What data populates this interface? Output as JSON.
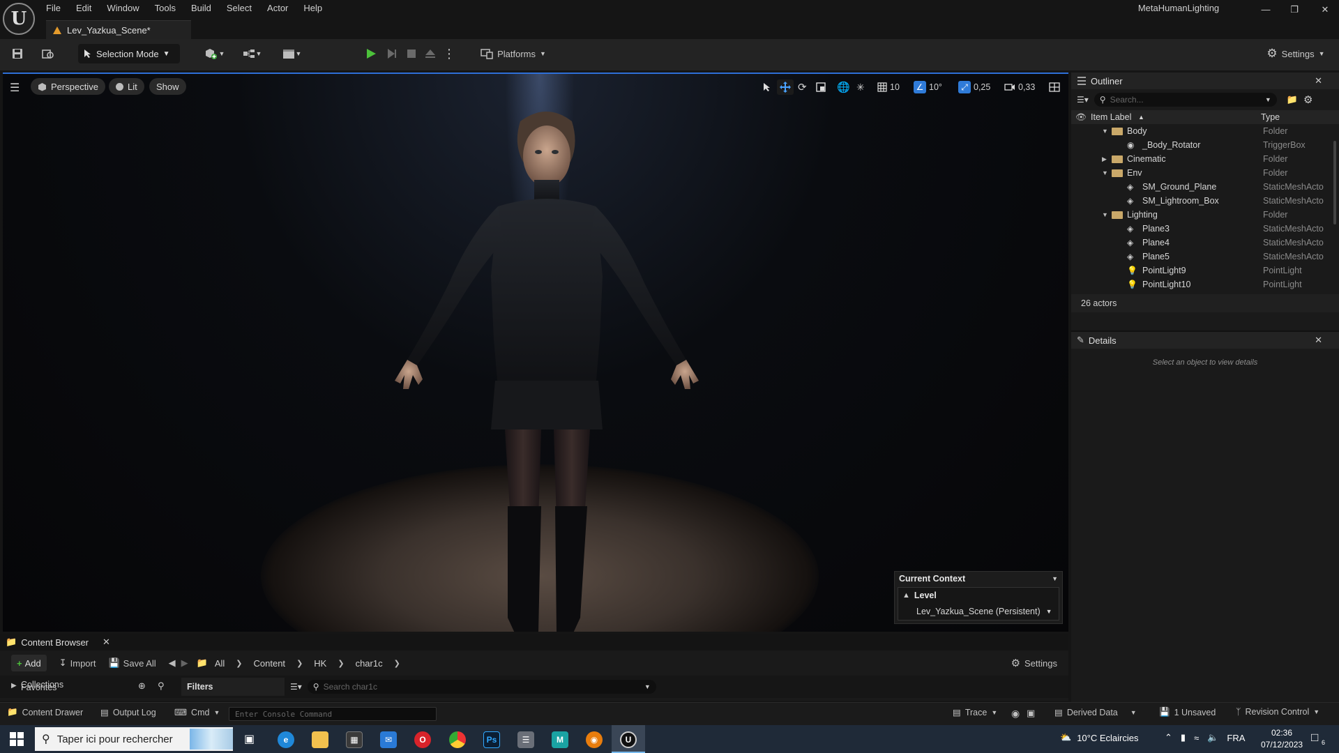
{
  "menu": [
    "File",
    "Edit",
    "Window",
    "Tools",
    "Build",
    "Select",
    "Actor",
    "Help"
  ],
  "app_name": "MetaHumanLighting",
  "document_tab": "Lev_Yazkua_Scene*",
  "toolbar": {
    "selection_mode": "Selection Mode",
    "platforms": "Platforms",
    "settings": "Settings"
  },
  "viewport": {
    "perspective": "Perspective",
    "lit": "Lit",
    "show": "Show",
    "grid_size": "10",
    "angle_snap": "10°",
    "scale_snap": "0,25",
    "camera_speed": "0,33"
  },
  "context": {
    "title": "Current Context",
    "level_label": "Level",
    "level_value": "Lev_Yazkua_Scene (Persistent)"
  },
  "outliner": {
    "title": "Outliner",
    "search_placeholder": "Search...",
    "col_label": "Item Label",
    "col_type": "Type",
    "items": [
      {
        "label": "Body",
        "type": "Folder",
        "indent": 0,
        "kind": "folder",
        "expanded": true
      },
      {
        "label": "_Body_Rotator",
        "type": "TriggerBox",
        "indent": 1,
        "kind": "trigger"
      },
      {
        "label": "Cinematic",
        "type": "Folder",
        "indent": 0,
        "kind": "folder",
        "expanded": false
      },
      {
        "label": "Env",
        "type": "Folder",
        "indent": 0,
        "kind": "folder",
        "expanded": true
      },
      {
        "label": "SM_Ground_Plane",
        "type": "StaticMeshActo",
        "indent": 1,
        "kind": "mesh"
      },
      {
        "label": "SM_Lightroom_Box",
        "type": "StaticMeshActo",
        "indent": 1,
        "kind": "mesh"
      },
      {
        "label": "Lighting",
        "type": "Folder",
        "indent": 0,
        "kind": "folder",
        "expanded": true
      },
      {
        "label": "Plane3",
        "type": "StaticMeshActo",
        "indent": 1,
        "kind": "mesh"
      },
      {
        "label": "Plane4",
        "type": "StaticMeshActo",
        "indent": 1,
        "kind": "mesh"
      },
      {
        "label": "Plane5",
        "type": "StaticMeshActo",
        "indent": 1,
        "kind": "mesh"
      },
      {
        "label": "PointLight9",
        "type": "PointLight",
        "indent": 1,
        "kind": "light"
      },
      {
        "label": "PointLight10",
        "type": "PointLight",
        "indent": 1,
        "kind": "light"
      }
    ],
    "count": "26 actors"
  },
  "details": {
    "title": "Details",
    "empty": "Select an object to view details"
  },
  "content_browser": {
    "title": "Content Browser",
    "add": "Add",
    "import": "Import",
    "save_all": "Save All",
    "crumbs": [
      "All",
      "Content",
      "HK",
      "char1c"
    ],
    "settings": "Settings",
    "collections": "Collections",
    "favorites": "Favorites",
    "filters": "Filters",
    "search_placeholder": "Search char1c"
  },
  "statusbar": {
    "content_drawer": "Content Drawer",
    "output_log": "Output Log",
    "cmd": "Cmd",
    "console_placeholder": "Enter Console Command",
    "trace": "Trace",
    "derived_data": "Derived Data",
    "unsaved": "1 Unsaved",
    "revision": "Revision Control"
  },
  "taskbar": {
    "search_placeholder": "Taper ici pour rechercher",
    "weather": "10°C  Eclaircies",
    "lang": "FRA",
    "time": "02:36",
    "date": "07/12/2023",
    "notif_count": "6"
  }
}
